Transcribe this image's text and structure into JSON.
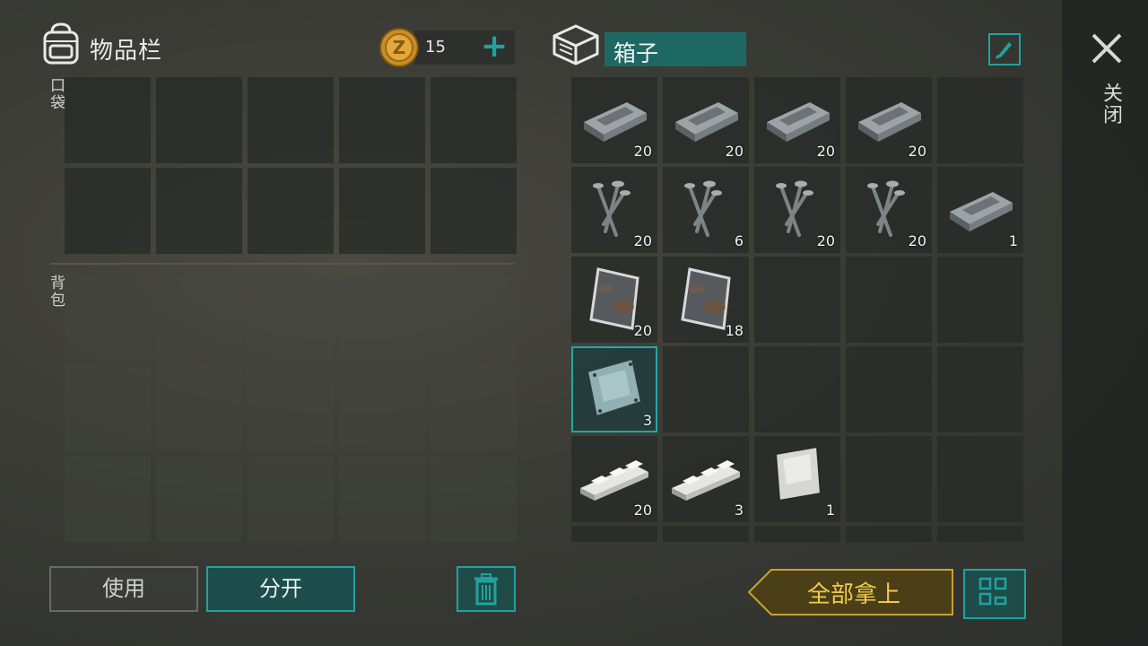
{
  "inventory": {
    "title": "物品栏",
    "pocket_label": "口袋",
    "backpack_label": "背包",
    "coins": "15",
    "add_label": "+"
  },
  "chest": {
    "title": "箱子",
    "slots": [
      {
        "item": "iron-ingot-icon",
        "count": "20"
      },
      {
        "item": "iron-ingot-icon",
        "count": "20"
      },
      {
        "item": "iron-ingot-icon",
        "count": "20"
      },
      {
        "item": "iron-ingot-icon",
        "count": "20"
      },
      {
        "item": "",
        "count": ""
      },
      {
        "item": "nails-icon",
        "count": "20"
      },
      {
        "item": "nails-icon",
        "count": "6"
      },
      {
        "item": "nails-icon",
        "count": "20"
      },
      {
        "item": "nails-icon",
        "count": "20"
      },
      {
        "item": "iron-ingot-icon",
        "count": "1"
      },
      {
        "item": "rusty-plate-icon",
        "count": "20"
      },
      {
        "item": "rusty-plate-icon",
        "count": "18"
      },
      {
        "item": "",
        "count": ""
      },
      {
        "item": "",
        "count": ""
      },
      {
        "item": "",
        "count": ""
      },
      {
        "item": "steel-plate-icon",
        "count": "3"
      },
      {
        "item": "",
        "count": ""
      },
      {
        "item": "",
        "count": ""
      },
      {
        "item": "",
        "count": ""
      },
      {
        "item": "",
        "count": ""
      },
      {
        "item": "aluminum-bar-icon",
        "count": "20"
      },
      {
        "item": "aluminum-bar-icon",
        "count": "3"
      },
      {
        "item": "aluminum-sheet-icon",
        "count": "1"
      },
      {
        "item": "",
        "count": ""
      },
      {
        "item": "",
        "count": ""
      }
    ]
  },
  "sidebar": {
    "close_label": "关闭"
  },
  "buttons": {
    "use": "使用",
    "split": "分开",
    "take_all": "全部拿上"
  },
  "colors": {
    "accent": "#1fa3a0",
    "gold": "#f3c84e",
    "panel": "#282a28"
  }
}
